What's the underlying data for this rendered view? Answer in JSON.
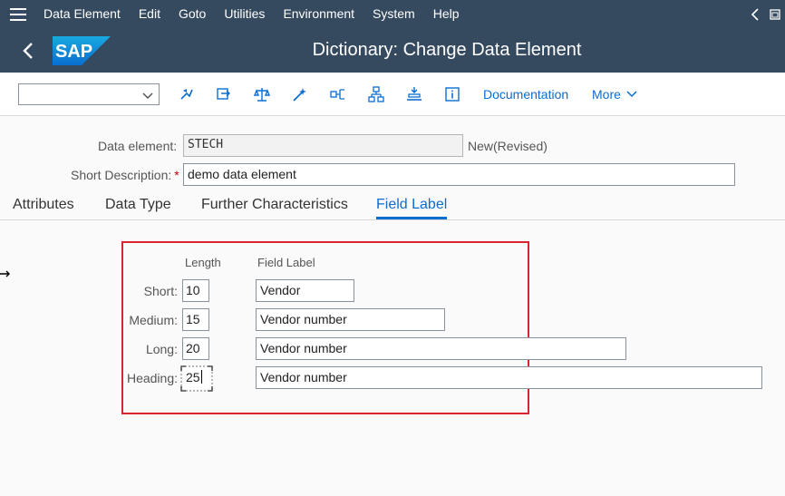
{
  "menubar": {
    "items": [
      "Data Element",
      "Edit",
      "Goto",
      "Utilities",
      "Environment",
      "System",
      "Help"
    ]
  },
  "titlebar": {
    "logo_text": "SAP",
    "title": "Dictionary: Change Data Element"
  },
  "toolbar": {
    "select_value": "",
    "icons": [
      "other-object-icon",
      "display-change-icon",
      "check-icon",
      "activate-icon",
      "where-used-icon",
      "hierarchy-icon",
      "navigation-icon",
      "information-icon"
    ],
    "documentation_label": "Documentation",
    "more_label": "More"
  },
  "header": {
    "data_element_label": "Data element:",
    "data_element_value": "STECH",
    "status": "New(Revised)",
    "short_desc_label": "Short Description:",
    "short_desc_required": "*",
    "short_desc_value": "demo data element"
  },
  "tabs": [
    {
      "label": "Attributes",
      "active": false
    },
    {
      "label": "Data Type",
      "active": false
    },
    {
      "label": "Further Characteristics",
      "active": false
    },
    {
      "label": "Field Label",
      "active": true
    }
  ],
  "field_labels": {
    "length_header": "Length",
    "label_header": "Field Label",
    "rows": [
      {
        "name": "Short:",
        "length": "10",
        "label": "Vendor"
      },
      {
        "name": "Medium:",
        "length": "15",
        "label": "Vendor number"
      },
      {
        "name": "Long:",
        "length": "20",
        "label": "Vendor number"
      },
      {
        "name": "Heading:",
        "length": "25",
        "label": "Vendor number"
      }
    ]
  },
  "colors": {
    "shell": "#354a5f",
    "accent": "#0a6ed1",
    "highlight": "#d9262c"
  }
}
